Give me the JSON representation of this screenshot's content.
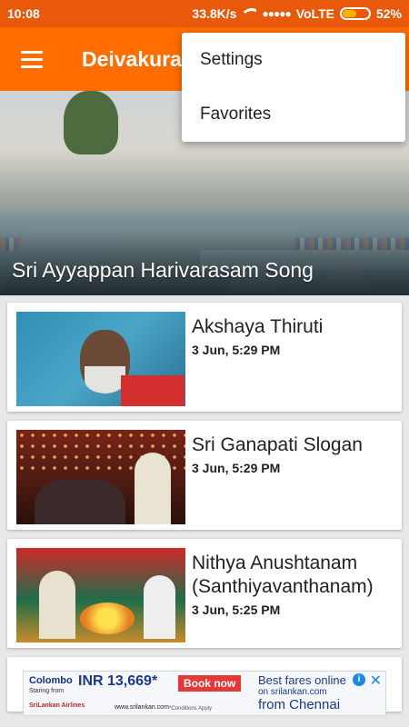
{
  "status_bar": {
    "time": "10:08",
    "network_speed": "33.8K/s",
    "signal": "●●●●●",
    "carrier": "VoLTE",
    "battery": "52%",
    "battery_level": 0.52
  },
  "app_bar": {
    "title": "Deivakura",
    "menu_icon": "hamburger-icon"
  },
  "overflow_menu": {
    "items": [
      {
        "label": "Settings"
      },
      {
        "label": "Favorites"
      }
    ]
  },
  "featured": {
    "title": "Sri Ayyappan Harivarasam Song"
  },
  "videos": [
    {
      "title": "Akshaya Thiruti",
      "date": "3 Jun, 5:29 PM"
    },
    {
      "title": "Sri Ganapati Slogan",
      "date": "3 Jun, 5:29 PM"
    },
    {
      "title": "Nithya Anushtanam (Santhiyavanthanam)",
      "date": "3 Jun, 5:25 PM"
    }
  ],
  "ad": {
    "city": "Colombo",
    "starting_from": "Staring from",
    "price": "INR 13,669*",
    "book_now": "Book now",
    "airline": "SriLankan Airlines",
    "url": "www.srilankan.com",
    "conditions": "*Conditions Apply",
    "best_fares": "Best fares online",
    "on_site": "on srilankan.com",
    "from_city": "from Chennai",
    "info": "i",
    "close": "✕"
  },
  "colors": {
    "status_bar": "#e8590c",
    "app_bar": "#ff6d00",
    "background": "#e8e8e8"
  }
}
